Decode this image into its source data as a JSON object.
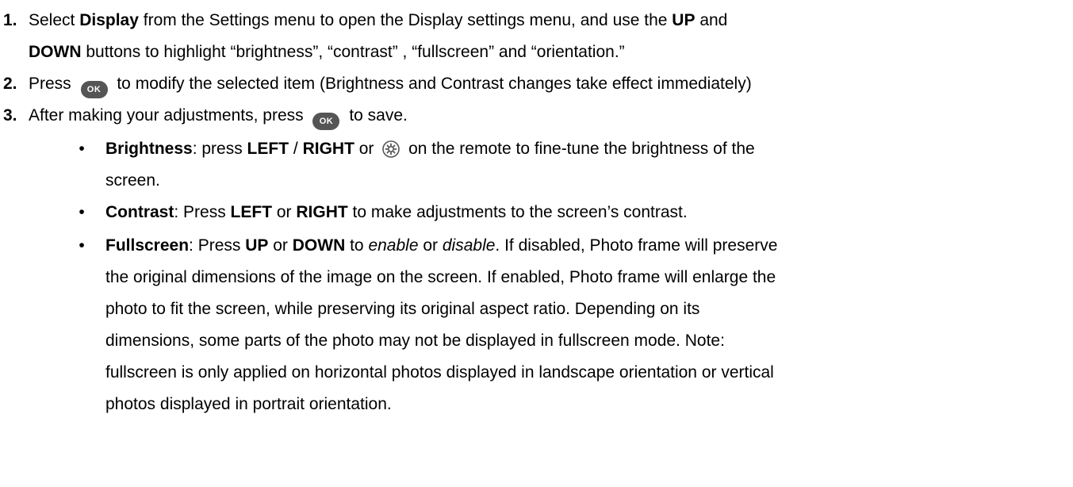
{
  "steps": [
    {
      "number": "1.",
      "line1": {
        "t1": "Select ",
        "b1": "Display",
        "t2": " from the Settings menu to open the Display settings menu, and use the ",
        "b2": "UP",
        "t3": " and"
      },
      "line2": {
        "b1": "DOWN",
        "t1": " buttons to highlight “brightness”, “contrast” , “fullscreen” and “orientation.”"
      }
    },
    {
      "number": "2.",
      "t1": "Press ",
      "icon": "ok-button-icon",
      "icon_text": "OK",
      "t2": " to modify the selected item (Brightness and Contrast changes take effect immediately)"
    },
    {
      "number": "3.",
      "t1": "After making your adjustments, press ",
      "icon": "ok-button-icon",
      "icon_text": "OK",
      "t2": " to save."
    }
  ],
  "bullets": {
    "brightness": {
      "label": "Brightness",
      "t1": ": press ",
      "b1": "LEFT",
      "t2": " / ",
      "b2": "RIGHT",
      "t3": " or ",
      "icon": "brightness-gear-icon",
      "t4": " on the remote to fine-tune the brightness of the",
      "t5": "screen."
    },
    "contrast": {
      "label": "Contrast",
      "t1": ": Press ",
      "b1": "LEFT",
      "t2": " or ",
      "b2": "RIGHT",
      "t3": " to make adjustments to the screen’s contrast."
    },
    "fullscreen": {
      "label": "Fullscreen",
      "t1": ": Press ",
      "b1": "UP",
      "t2": " or ",
      "b2": "DOWN",
      "t3": " to ",
      "i1": "enable",
      "t4": " or ",
      "i2": "disable",
      "t5": ". If disabled, Photo frame will preserve",
      "lines": [
        "the original dimensions of the image on the screen. If enabled, Photo frame will enlarge the",
        "photo to fit the screen, while preserving its original aspect ratio. Depending on its",
        "dimensions, some parts of the photo may not be displayed in fullscreen mode. Note:",
        "fullscreen is only applied on horizontal photos displayed in landscape orientation or vertical",
        "photos displayed in portrait orientation."
      ]
    }
  }
}
